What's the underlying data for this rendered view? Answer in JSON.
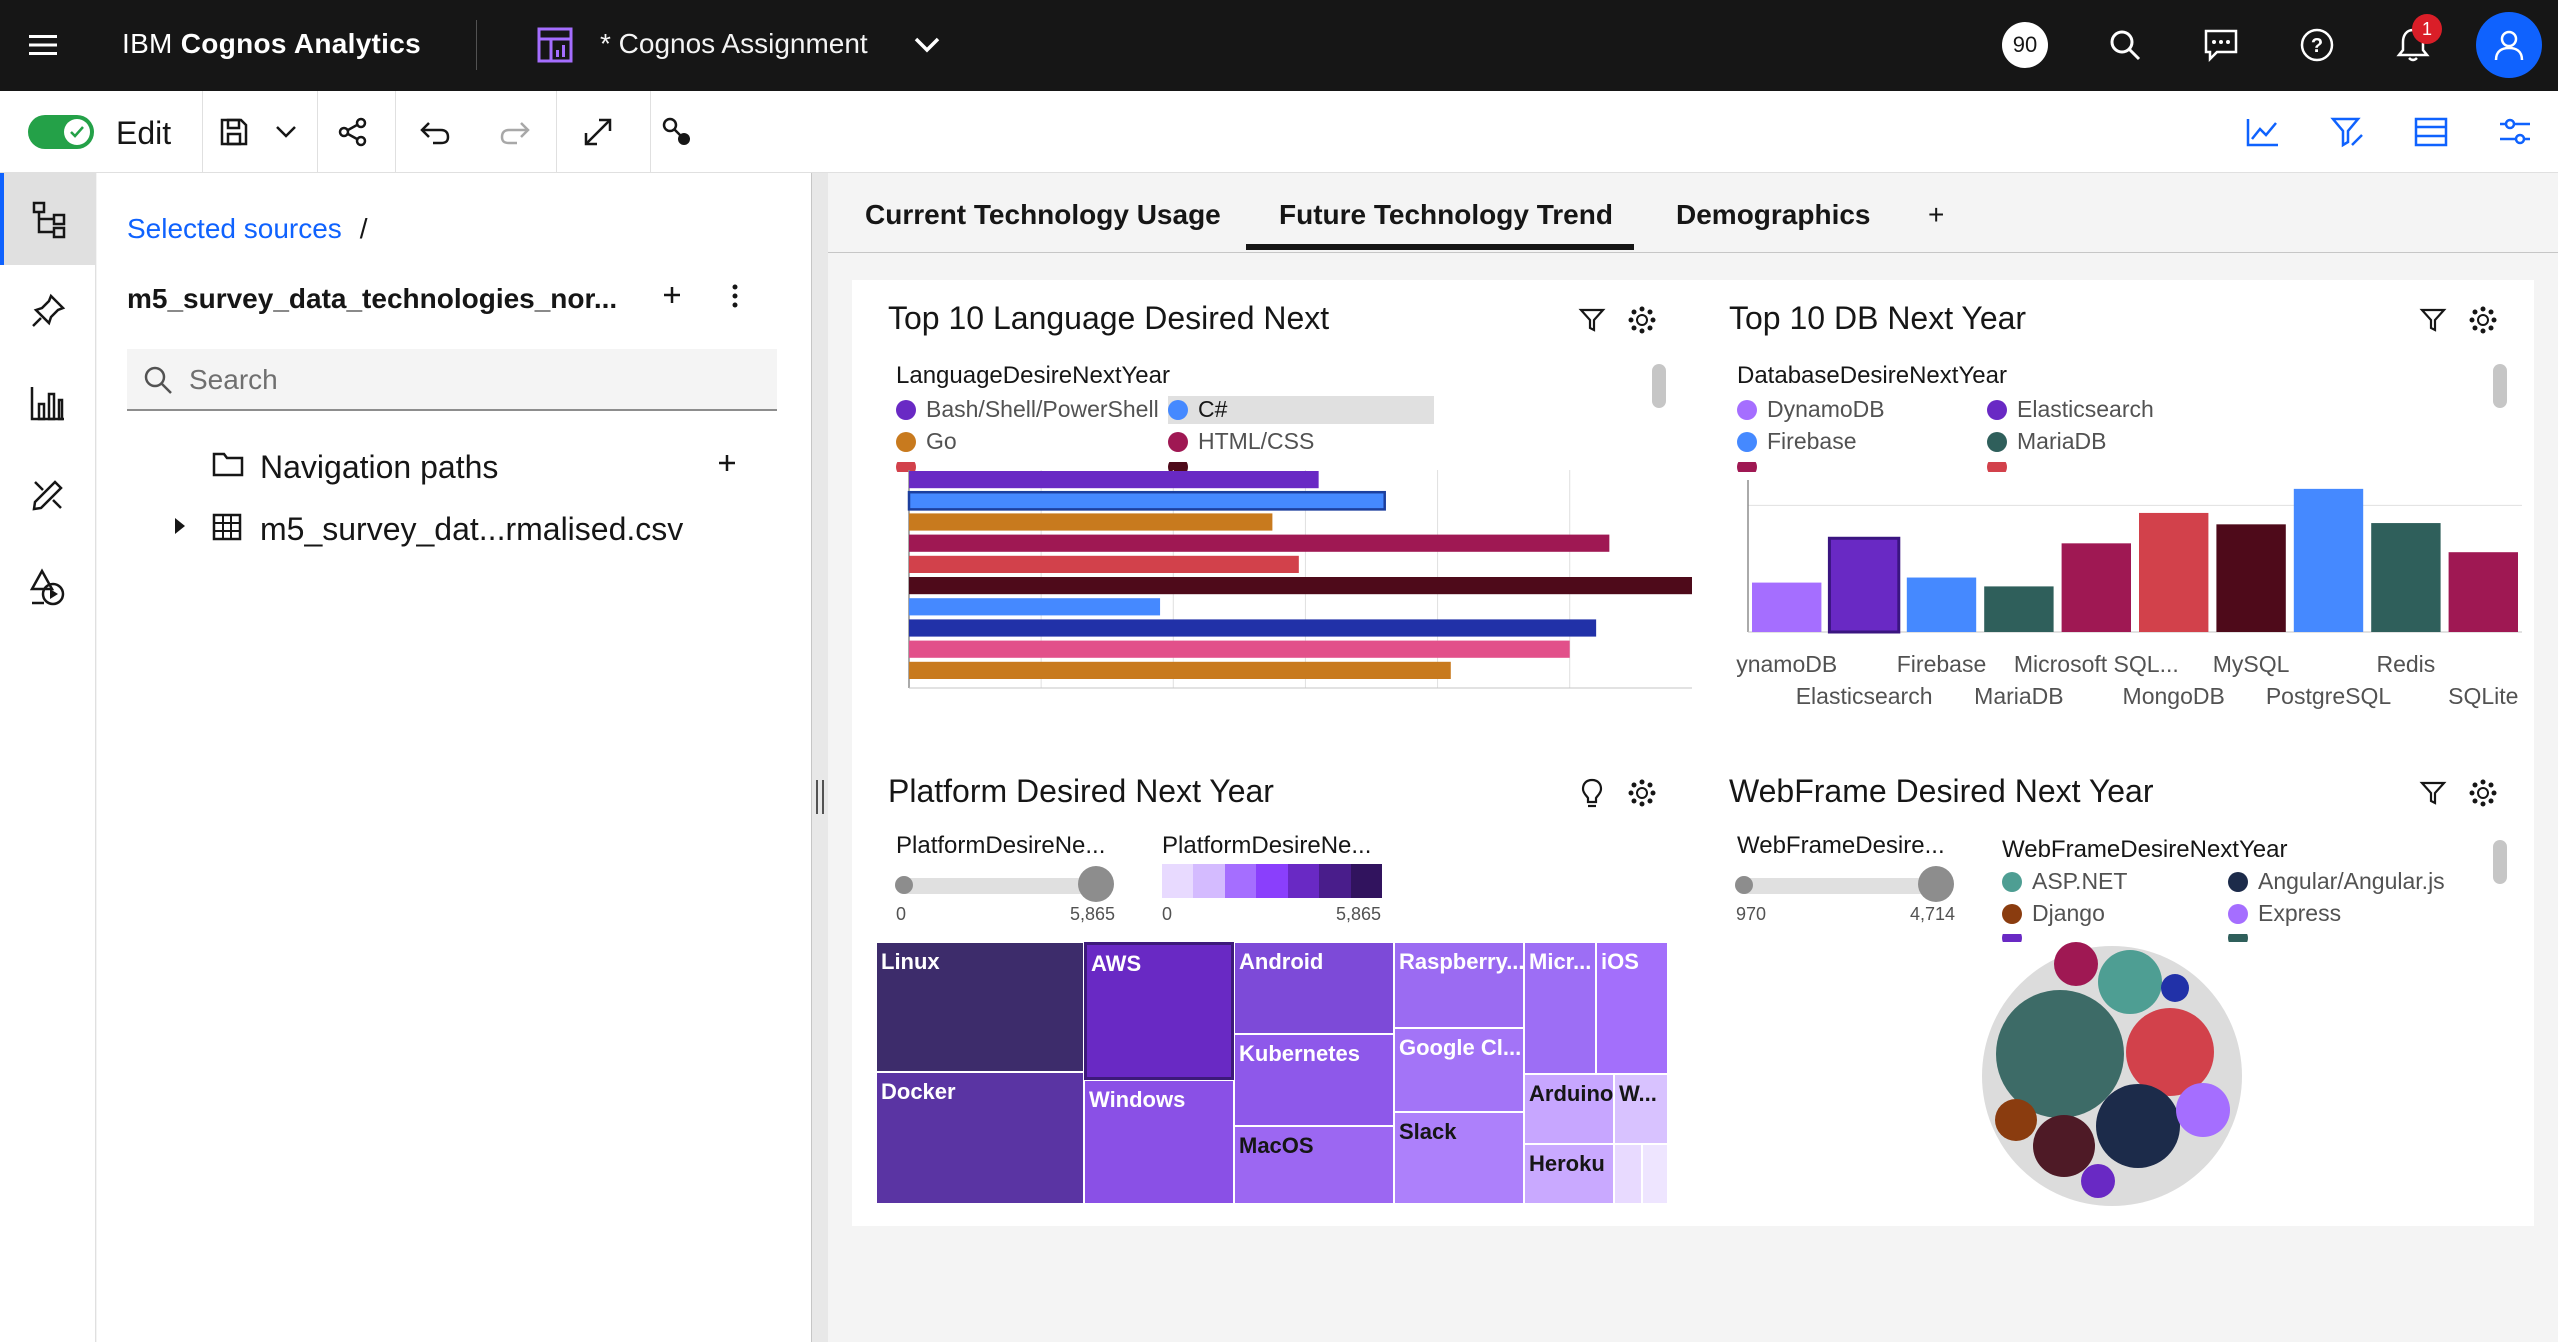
{
  "topbar": {
    "brand_prefix": "IBM ",
    "brand_name": "Cognos Analytics",
    "report_title": "* Cognos Assignment",
    "badge": "90",
    "notification_count": "1"
  },
  "toolbar": {
    "edit_label": "Edit"
  },
  "source_panel": {
    "breadcrumb_link": "Selected sources",
    "breadcrumb_sep": "/",
    "source_name": "m5_survey_data_technologies_nor...",
    "search_placeholder": "Search",
    "nav_paths_label": "Navigation paths",
    "csv_label": "m5_survey_dat...rmalised.csv"
  },
  "tabs": [
    {
      "label": "Current Technology Usage"
    },
    {
      "label": "Future Technology Trend"
    },
    {
      "label": "Demographics"
    },
    {
      "label": "+"
    }
  ],
  "widgets": {
    "lang": {
      "title": "Top 10 Language Desired Next",
      "legend_title": "LanguageDesireNextYear",
      "legend": [
        {
          "label": "Bash/Shell/PowerShell",
          "color": "#6929c4"
        },
        {
          "label": "C#",
          "color": "#4589ff"
        },
        {
          "label": "Go",
          "color": "#c87a1e"
        },
        {
          "label": "HTML/CSS",
          "color": "#9f1853"
        }
      ]
    },
    "db": {
      "title": "Top 10 DB Next Year",
      "legend_title": "DatabaseDesireNextYear",
      "legend": [
        {
          "label": "DynamoDB",
          "color": "#a56eff"
        },
        {
          "label": "Elasticsearch",
          "color": "#6929c4"
        },
        {
          "label": "Firebase",
          "color": "#4589ff"
        },
        {
          "label": "MariaDB",
          "color": "#2f5f5b"
        }
      ]
    },
    "platform": {
      "title": "Platform Desired Next Year",
      "slider_label_1": "PlatformDesireNe...",
      "slider_label_2": "PlatformDesireNe...",
      "slider_min": "0",
      "slider_max": "5,865",
      "color_min": "0",
      "color_max": "5,865",
      "cells": [
        {
          "label": "Linux"
        },
        {
          "label": "AWS"
        },
        {
          "label": "Android"
        },
        {
          "label": "Raspberry..."
        },
        {
          "label": "Micr..."
        },
        {
          "label": "iOS"
        },
        {
          "label": "Docker"
        },
        {
          "label": "Windows"
        },
        {
          "label": "Kubernetes"
        },
        {
          "label": "Google Cl..."
        },
        {
          "label": "Arduino"
        },
        {
          "label": "W..."
        },
        {
          "label": "MacOS"
        },
        {
          "label": "Slack"
        },
        {
          "label": "Heroku"
        }
      ]
    },
    "webframe": {
      "title": "WebFrame Desired Next Year",
      "slider_label": "WebFrameDesire...",
      "slider_min": "970",
      "slider_max": "4,714",
      "legend_title": "WebFrameDesireNextYear",
      "legend": [
        {
          "label": "ASP.NET",
          "color": "#4e9e93"
        },
        {
          "label": "Angular/Angular.js",
          "color": "#1c2b4a"
        },
        {
          "label": "Django",
          "color": "#8a3c0f"
        },
        {
          "label": "Express",
          "color": "#a56eff"
        }
      ]
    }
  },
  "chart_data": [
    {
      "type": "bar",
      "orientation": "horizontal",
      "title": "Top 10 Language Desired Next",
      "legend_title": "LanguageDesireNextYear",
      "values": [
        3100,
        3600,
        2750,
        5300,
        2950,
        6600,
        1900,
        5200,
        5000,
        4100
      ],
      "colors": [
        "#6929c4",
        "#4589ff",
        "#c87a1e",
        "#9f1853",
        "#d2414b",
        "#4e0a1a",
        "#4589ff",
        "#2131a8",
        "#e2508a",
        "#c87a1e"
      ],
      "xlim": [
        0,
        7000
      ],
      "xticks": [
        "0",
        "1,000",
        "2,000",
        "3,000",
        "4,000",
        "5,000",
        "6,000",
        "7,000"
      ]
    },
    {
      "type": "bar",
      "title": "Top 10 DB Next Year",
      "legend_title": "DatabaseDesireNextYear",
      "categories": [
        "DynamoDB",
        "Elasticsearch",
        "Firebase",
        "MariaDB",
        "Microsoft SQL...",
        "MongoDB",
        "MySQL",
        "PostgreSQL",
        "Redis",
        "SQLite"
      ],
      "values": [
        1950,
        3700,
        2150,
        1800,
        3500,
        4700,
        4250,
        5650,
        4300,
        3150
      ],
      "colors": [
        "#a56eff",
        "#6929c4",
        "#4589ff",
        "#2f5f5b",
        "#9f1853",
        "#d2414b",
        "#4e0a1a",
        "#4589ff",
        "#2f5f5b",
        "#9f1853"
      ],
      "ylim": [
        0,
        6000
      ],
      "tick_labels_row1": [
        "ynamoDB",
        "Firebase",
        "Microsoft SQL...",
        "MySQL",
        "Redis"
      ],
      "tick_labels_row2": [
        "Elasticsearch",
        "MariaDB",
        "MongoDB",
        "PostgreSQL",
        "SQLite"
      ]
    }
  ]
}
